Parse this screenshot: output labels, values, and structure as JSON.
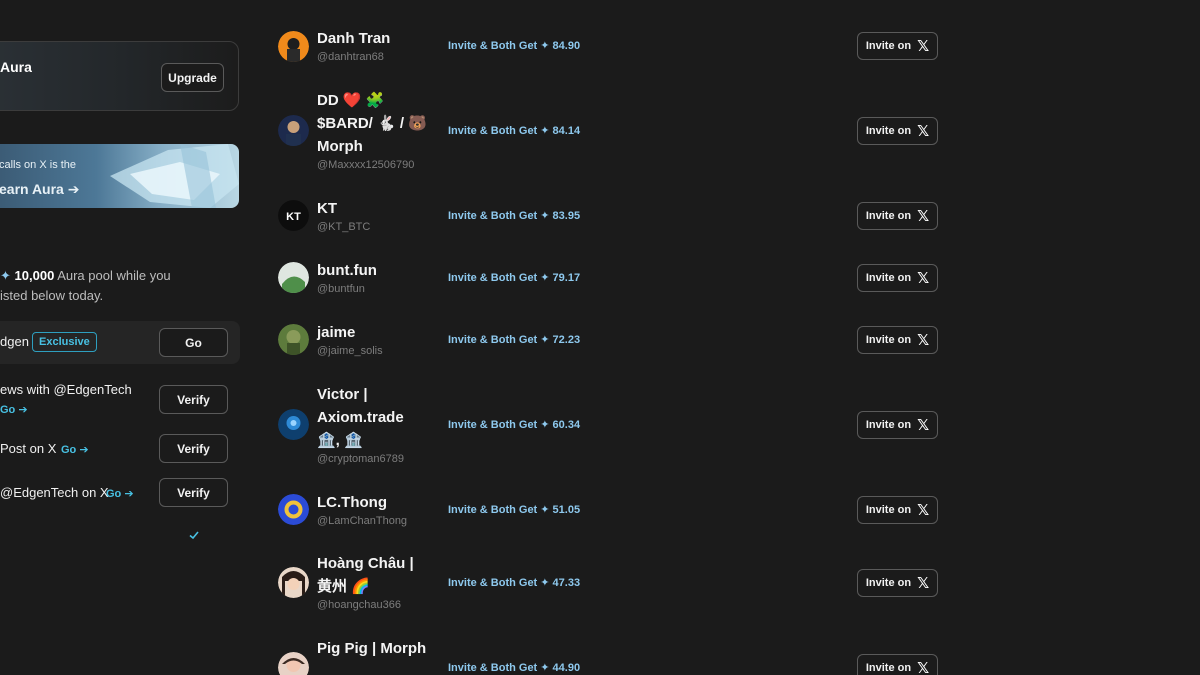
{
  "sidebar": {
    "aura_card": {
      "title": "Aura",
      "upgrade_label": "Upgrade"
    },
    "banner": {
      "text": "calls on X is the",
      "link": "earn Aura ➔"
    },
    "pool": {
      "star": "✦",
      "amount": "10,000",
      "line1_rest": " Aura pool while you",
      "line2": "isted below today."
    },
    "tasks": [
      {
        "label": "dgen",
        "badge": "Exclusive",
        "button": "Go"
      },
      {
        "label": "ews with @EdgenTech",
        "link": "Go ➔",
        "button": "Verify"
      },
      {
        "label": "Post on X",
        "link": "Go ➔",
        "button": "Verify"
      },
      {
        "label": "@EdgenTech on X",
        "link": "Go ➔",
        "button": "Verify"
      }
    ]
  },
  "users": [
    {
      "name": "Danh Tran",
      "handle": "@danhtran68",
      "reward": "Invite & Both Get ✦ 84.90",
      "button": "Invite on"
    },
    {
      "name": "DD ❤️ 🧩 $BARD/ 🐇 / 🐻 Morph",
      "handle": "@Maxxxx12506790",
      "reward": "Invite & Both Get ✦ 84.14",
      "button": "Invite on"
    },
    {
      "name": "KT",
      "handle": "@KT_BTC",
      "reward": "Invite & Both Get ✦ 83.95",
      "button": "Invite on"
    },
    {
      "name": "bunt.fun",
      "handle": "@buntfun",
      "reward": "Invite & Both Get ✦ 79.17",
      "button": "Invite on"
    },
    {
      "name": "jaime",
      "handle": "@jaime_solis",
      "reward": "Invite & Both Get ✦ 72.23",
      "button": "Invite on"
    },
    {
      "name": "Victor | Axiom.trade 🏦, 🏦",
      "handle": "@cryptoman6789",
      "reward": "Invite & Both Get ✦ 60.34",
      "button": "Invite on"
    },
    {
      "name": "LC.Thong",
      "handle": "@LamChanThong",
      "reward": "Invite & Both Get ✦ 51.05",
      "button": "Invite on"
    },
    {
      "name": "Hoàng Châu | 黄州 🌈",
      "handle": "@hoangchau366",
      "reward": "Invite & Both Get ✦ 47.33",
      "button": "Invite on"
    },
    {
      "name": "Pig Pig | Morph",
      "handle": "",
      "reward": "Invite & Both Get ✦ 44.90",
      "button": "Invite on"
    }
  ],
  "icons": {
    "x": "𝕏",
    "check": "check-icon"
  },
  "colors": {
    "accent": "#48c1e3",
    "reward": "#8ec9ee",
    "background": "#1b1b1b"
  }
}
